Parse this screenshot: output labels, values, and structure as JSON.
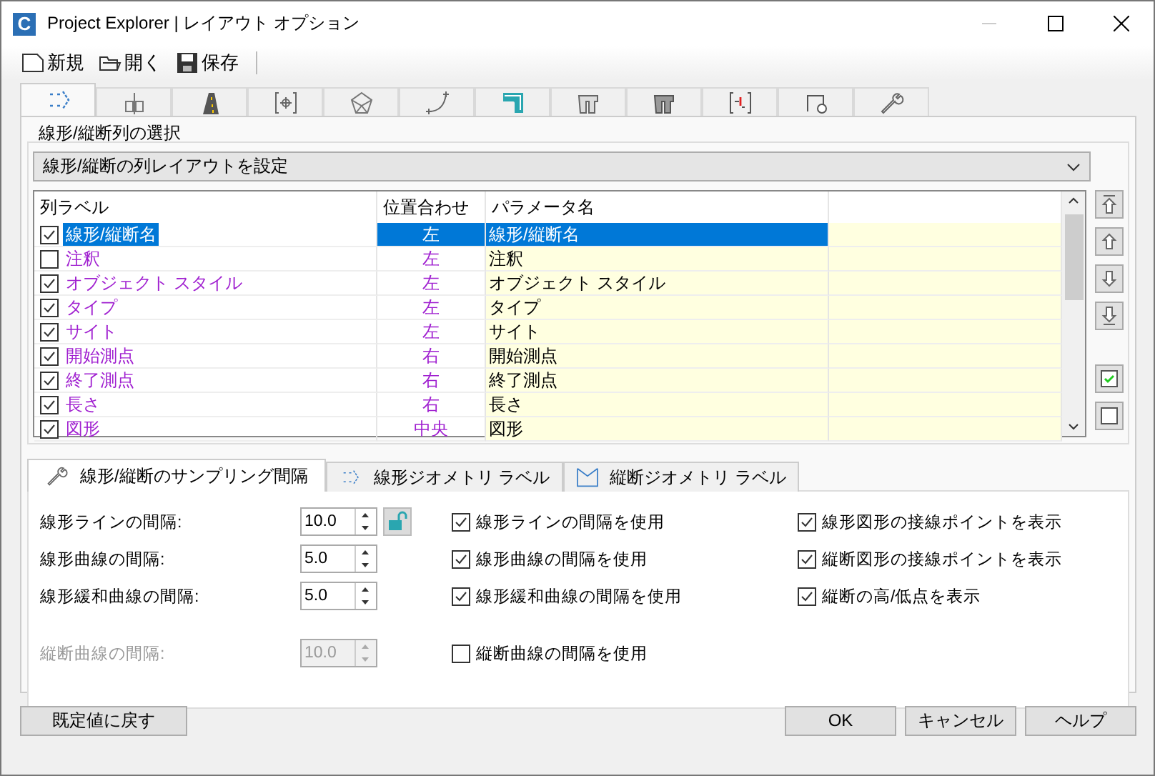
{
  "window": {
    "icon": "C",
    "title": "Project Explorer | レイアウト オプション"
  },
  "toolbar": [
    {
      "label": "新規"
    },
    {
      "label": "開く"
    },
    {
      "label": "保存"
    }
  ],
  "tabs": [
    {
      "selected": true
    },
    {
      "selected": false
    },
    {
      "selected": false
    },
    {
      "selected": false
    },
    {
      "selected": false
    },
    {
      "selected": false
    },
    {
      "selected": false
    },
    {
      "selected": false
    },
    {
      "selected": false
    },
    {
      "selected": false
    },
    {
      "selected": false
    },
    {
      "selected": false
    }
  ],
  "column_selection": {
    "title": "線形/縦断列の選択",
    "dropdown": "線形/縦断の列レイアウトを設定",
    "columns": [
      "列ラベル",
      "位置合わせ",
      "パラメータ名"
    ],
    "rows": [
      {
        "checked": true,
        "label": "線形/縦断名",
        "align": "左",
        "parameter": "線形/縦断名",
        "selected": true
      },
      {
        "checked": false,
        "label": "注釈",
        "align": "左",
        "parameter": "注釈",
        "selected": false
      },
      {
        "checked": true,
        "label": "オブジェクト スタイル",
        "align": "左",
        "parameter": "オブジェクト スタイル",
        "selected": false
      },
      {
        "checked": true,
        "label": "タイプ",
        "align": "左",
        "parameter": "タイプ",
        "selected": false
      },
      {
        "checked": true,
        "label": "サイト",
        "align": "左",
        "parameter": "サイト",
        "selected": false
      },
      {
        "checked": true,
        "label": "開始測点",
        "align": "右",
        "parameter": "開始測点",
        "selected": false
      },
      {
        "checked": true,
        "label": "終了測点",
        "align": "右",
        "parameter": "終了測点",
        "selected": false
      },
      {
        "checked": true,
        "label": "長さ",
        "align": "右",
        "parameter": "長さ",
        "selected": false
      },
      {
        "checked": true,
        "label": "図形",
        "align": "中央",
        "parameter": "図形",
        "selected": false
      }
    ]
  },
  "sub_tabs": [
    {
      "label": "線形/縦断のサンプリング間隔",
      "selected": true
    },
    {
      "label": "線形ジオメトリ ラベル",
      "selected": false
    },
    {
      "label": "縦断ジオメトリ ラベル",
      "selected": false
    }
  ],
  "sampling": {
    "fields": [
      {
        "label": "線形ラインの間隔:",
        "value": "10.0",
        "disabled": false,
        "lock": true
      },
      {
        "label": "線形曲線の間隔:",
        "value": "5.0",
        "disabled": false,
        "lock": false
      },
      {
        "label": "線形緩和曲線の間隔:",
        "value": "5.0",
        "disabled": false,
        "lock": false
      },
      {
        "label": "縦断曲線の間隔:",
        "value": "10.0",
        "disabled": true,
        "lock": false
      }
    ],
    "use_checks": [
      {
        "label": "線形ラインの間隔を使用",
        "checked": true
      },
      {
        "label": "線形曲線の間隔を使用",
        "checked": true
      },
      {
        "label": "線形緩和曲線の間隔を使用",
        "checked": true
      },
      {
        "label": "縦断曲線の間隔を使用",
        "checked": false
      }
    ],
    "display_checks": [
      {
        "label": "線形図形の接線ポイントを表示",
        "checked": true
      },
      {
        "label": "縦断図形の接線ポイントを表示",
        "checked": true
      },
      {
        "label": "縦断の高/低点を表示",
        "checked": true
      }
    ]
  },
  "buttons": {
    "reset": "既定値に戻す",
    "actions": [
      "OK",
      "キャンセル",
      "ヘルプ"
    ]
  }
}
